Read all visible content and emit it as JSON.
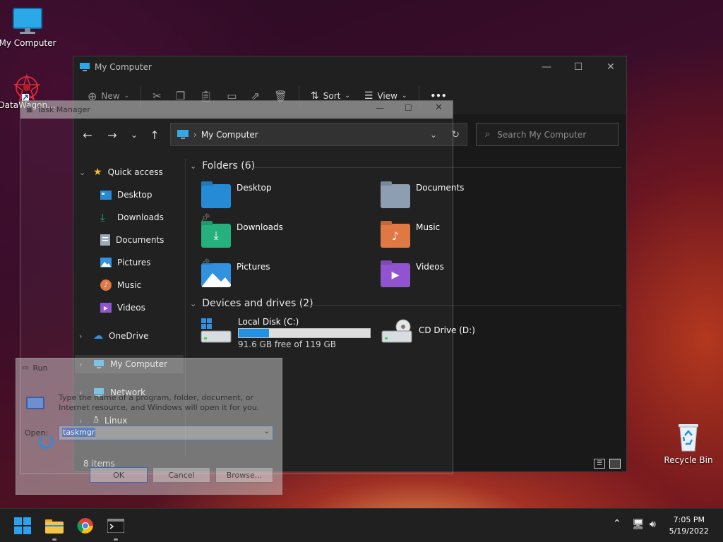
{
  "desktop": {
    "icons": [
      {
        "label": "My Computer"
      },
      {
        "label": "DataWagon..."
      },
      {
        "label": "Recycle Bin"
      }
    ]
  },
  "explorer": {
    "title": "My Computer",
    "commands": {
      "new": "New",
      "sort": "Sort",
      "view": "View",
      "more": "•••"
    },
    "address": "My Computer",
    "search_placeholder": "Search My Computer",
    "sidebar": {
      "quick_access": "Quick access",
      "items": [
        {
          "label": "Desktop",
          "pinned": true
        },
        {
          "label": "Downloads",
          "pinned": true
        },
        {
          "label": "Documents",
          "pinned": true
        },
        {
          "label": "Pictures",
          "pinned": true
        },
        {
          "label": "Music",
          "pinned": false
        },
        {
          "label": "Videos",
          "pinned": false
        }
      ],
      "onedrive": "OneDrive",
      "my_computer": "My Computer",
      "network": "Network",
      "linux": "Linux"
    },
    "folders_header": "Folders (6)",
    "folders": [
      {
        "label": "Desktop",
        "color": "#1e88d6"
      },
      {
        "label": "Documents",
        "color": "#8a9bb0"
      },
      {
        "label": "Downloads",
        "color": "#1fae7a"
      },
      {
        "label": "Music",
        "color": "#e0743e"
      },
      {
        "label": "Pictures",
        "color": "#2b8fe0"
      },
      {
        "label": "Videos",
        "color": "#8e4fd0"
      }
    ],
    "drives_header": "Devices and drives (2)",
    "drives": [
      {
        "label": "Local Disk (C:)",
        "free": "91.6 GB free of 119 GB",
        "used_fraction": 0.23
      },
      {
        "label": "CD Drive (D:)"
      }
    ],
    "status": "8 items"
  },
  "task_manager": {
    "title": "Task Manager"
  },
  "run_dialog": {
    "title": "Run",
    "description": "Type the name of a program, folder, document, or Internet resource, and Windows will open it for you.",
    "open_label": "Open:",
    "value": "taskmgr",
    "ok": "OK",
    "cancel": "Cancel",
    "browse": "Browse..."
  },
  "taskbar": {
    "time": "7:05 PM",
    "date": "5/19/2022"
  }
}
